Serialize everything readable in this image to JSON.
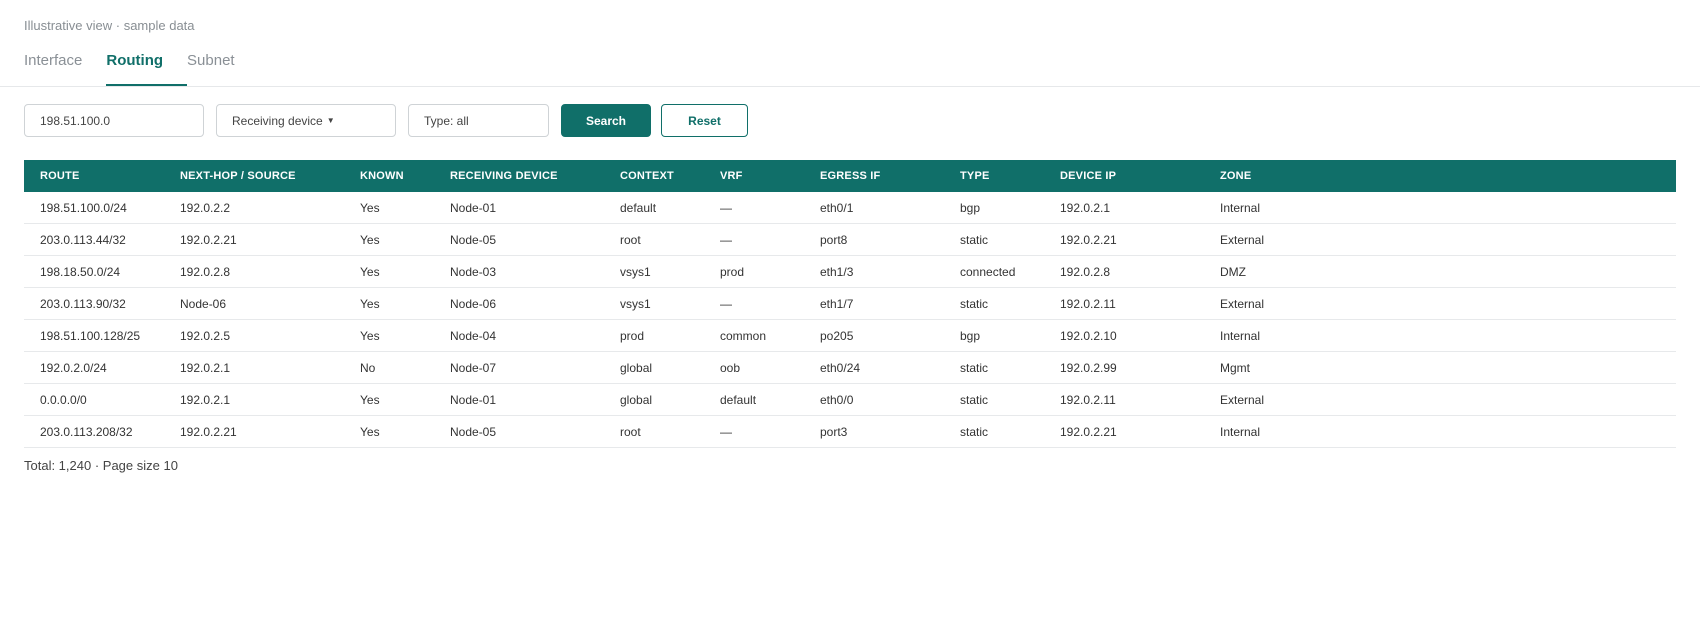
{
  "caption": "Illustrative view · sample data",
  "tabs": [
    {
      "label": "Interface",
      "active": false
    },
    {
      "label": "Routing",
      "active": true
    },
    {
      "label": "Subnet",
      "active": false
    }
  ],
  "toolbar": {
    "search_value": "198.51.100.0",
    "device_select": "Receiving device",
    "type_select": "Type: all",
    "search_label": "Search",
    "reset_label": "Reset"
  },
  "colors": {
    "accent": "#106f69",
    "negative": "#b3261e"
  },
  "table": {
    "columns": [
      "ROUTE",
      "NEXT-HOP / SOURCE",
      "KNOWN",
      "RECEIVING DEVICE",
      "CONTEXT",
      "VRF",
      "EGRESS IF",
      "TYPE",
      "DEVICE IP",
      "ZONE"
    ],
    "rows": [
      [
        "198.51.100.0/24",
        "192.0.2.2",
        "Yes",
        "Node-01",
        "default",
        "—",
        "eth0/1",
        "bgp",
        "192.0.2.1",
        "Internal"
      ],
      [
        "203.0.113.44/32",
        "192.0.2.21",
        "Yes",
        "Node-05",
        "root",
        "—",
        "port8",
        "static",
        "192.0.2.21",
        "External"
      ],
      [
        "198.18.50.0/24",
        "192.0.2.8",
        "Yes",
        "Node-03",
        "vsys1",
        "prod",
        "eth1/3",
        "connected",
        "192.0.2.8",
        "DMZ"
      ],
      [
        "203.0.113.90/32",
        "Node-06",
        "Yes",
        "Node-06",
        "vsys1",
        "—",
        "eth1/7",
        "static",
        "192.0.2.11",
        "External"
      ],
      [
        "198.51.100.128/25",
        "192.0.2.5",
        "Yes",
        "Node-04",
        "prod",
        "common",
        "po205",
        "bgp",
        "192.0.2.10",
        "Internal"
      ],
      [
        "192.0.2.0/24",
        "192.0.2.1",
        "No",
        "Node-07",
        "global",
        "oob",
        "eth0/24",
        "static",
        "192.0.2.99",
        "Mgmt"
      ],
      [
        "0.0.0.0/0",
        "192.0.2.1",
        "Yes",
        "Node-01",
        "global",
        "default",
        "eth0/0",
        "static",
        "192.0.2.11",
        "External"
      ],
      [
        "203.0.113.208/32",
        "192.0.2.21",
        "Yes",
        "Node-05",
        "root",
        "—",
        "port3",
        "static",
        "192.0.2.21",
        "Internal"
      ]
    ]
  },
  "footer": {
    "summary": "Total: 1,240 · Page size 10"
  }
}
